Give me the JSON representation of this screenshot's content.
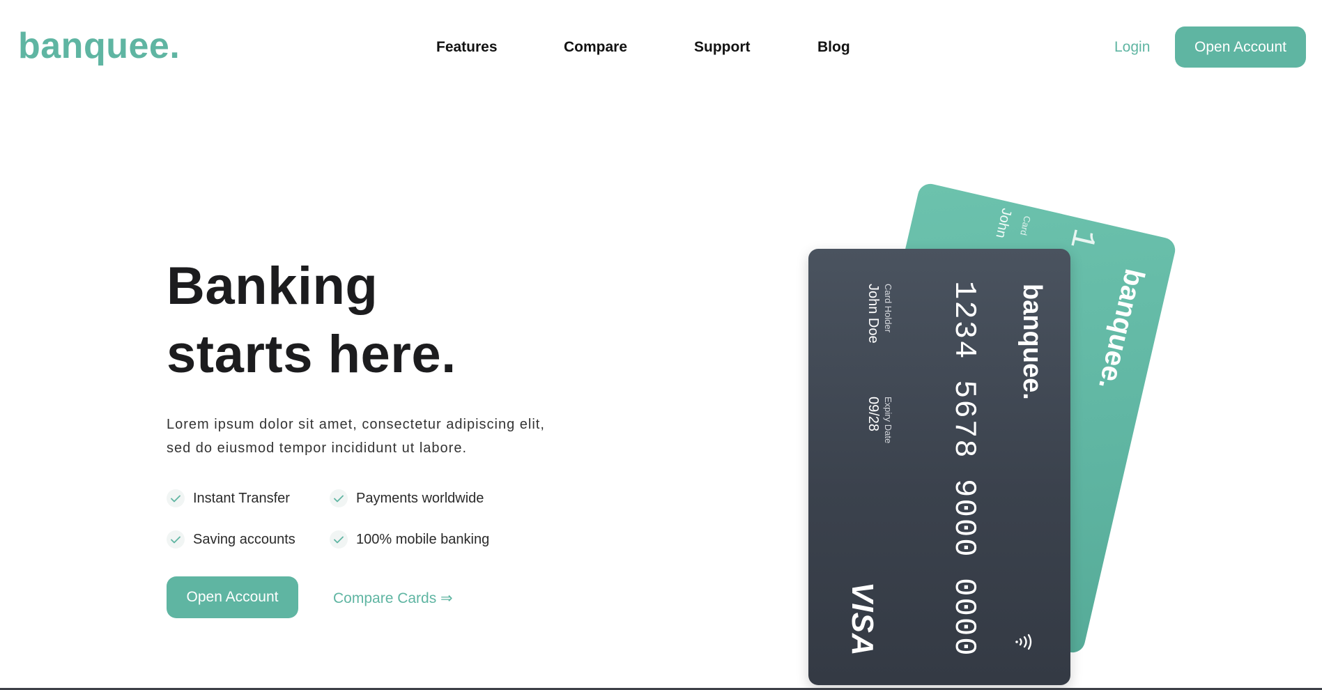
{
  "brand": {
    "logo": "banquee."
  },
  "nav": {
    "items": [
      {
        "label": "Features"
      },
      {
        "label": "Compare"
      },
      {
        "label": "Support"
      },
      {
        "label": "Blog"
      }
    ],
    "login_label": "Login",
    "cta_label": "Open Account"
  },
  "hero": {
    "title_line1": "Banking",
    "title_line2": "starts here.",
    "desc_line1": "Lorem ipsum dolor sit amet, consectetur adipiscing elit,",
    "desc_line2": "sed do eiusmod tempor incididunt ut labore.",
    "features": [
      {
        "label": "Instant Transfer"
      },
      {
        "label": "Payments worldwide"
      },
      {
        "label": "Saving accounts"
      },
      {
        "label": "100% mobile banking"
      }
    ],
    "cta_label": "Open Account",
    "compare_label": "Compare Cards ⇒"
  },
  "cards": {
    "front": {
      "brand": "banquee.",
      "number": "1234 5678 9000 0000",
      "holder_label": "Card Holder",
      "holder_name": "John Doe",
      "expiry_label": "Expiry Date",
      "expiry_value": "09/28",
      "network": "VISA"
    },
    "back": {
      "brand": "banquee.",
      "number_fragment": "1",
      "holder_label_fragment": "Card",
      "holder_name_fragment": "John"
    }
  },
  "colors": {
    "accent": "#5fb5a2",
    "card_dark": "#3b424d",
    "text_dark": "#1c1c1e"
  },
  "icons": {
    "check": "check-icon",
    "contactless": "contactless-icon",
    "arrow": "double-arrow-right"
  }
}
